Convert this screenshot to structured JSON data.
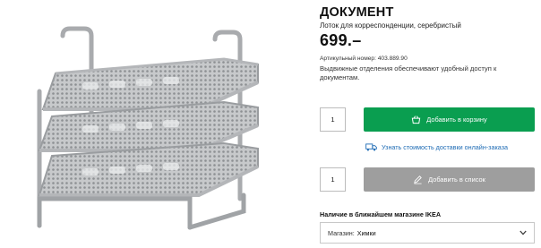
{
  "product": {
    "name": "ДОКУМЕНТ",
    "subtitle": "Лоток для корреспонденции, серебристый",
    "price": "699.–",
    "article_label": "Артикульный номер:",
    "article_number": "403.889.90",
    "description": "Выдвижные отделения обеспечивают удобный доступ к документам."
  },
  "cart": {
    "quantity": "1",
    "button_label": "Добавить в корзину"
  },
  "delivery": {
    "link_label": "Узнать стоимость доставки онлайн-заказа"
  },
  "wishlist": {
    "quantity": "1",
    "button_label": "Добавить в список"
  },
  "store": {
    "heading": "Наличие в ближайшем магазине IKEA",
    "select_label": "Магазин:",
    "select_value": "Химки"
  },
  "colors": {
    "cart_button": "#0a9e50",
    "list_button": "#9e9e9e",
    "link": "#1f6cb5"
  },
  "icons": [
    "basket-icon",
    "truck-icon",
    "pencil-icon",
    "chevron-down-icon"
  ]
}
